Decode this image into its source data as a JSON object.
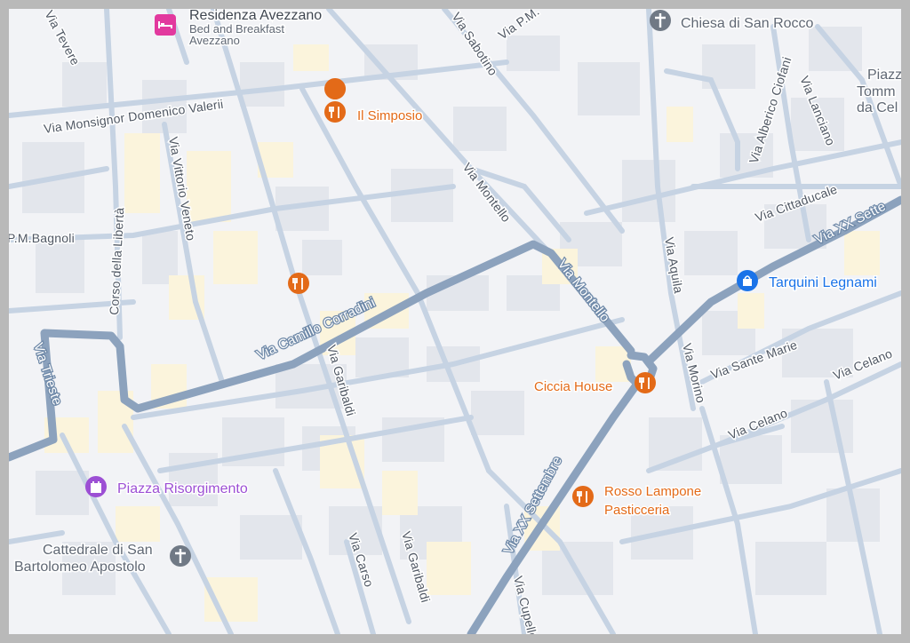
{
  "map": {
    "streets": [
      {
        "id": "via-monsignor-domenico-valerii",
        "label": "Via Monsignor Domenico Valerii"
      },
      {
        "id": "via-tevere",
        "label": "Via Tevere"
      },
      {
        "id": "via-sabotino",
        "label": "Via Sabotino"
      },
      {
        "id": "via-p-m",
        "label": "Via P.M."
      },
      {
        "id": "via-p-m-bagnoli",
        "label": "P.M.Bagnoli"
      },
      {
        "id": "corso-della-liberta",
        "label": "Corso della Libertà"
      },
      {
        "id": "via-vittorio-veneto",
        "label": "Via Vittorio Veneto"
      },
      {
        "id": "via-montello-upper",
        "label": "Via Montello"
      },
      {
        "id": "via-montello-lower",
        "label": "Via Montello"
      },
      {
        "id": "via-camillo-corradini",
        "label": "Via Camillo Corradini"
      },
      {
        "id": "via-trieste",
        "label": "Via Trieste"
      },
      {
        "id": "via-garibaldi-upper",
        "label": "Via Garibaldi"
      },
      {
        "id": "via-garibaldi-lower",
        "label": "Via Garibaldi"
      },
      {
        "id": "via-carso",
        "label": "Via Carso"
      },
      {
        "id": "via-xx-settembre-lower",
        "label": "Via XX Settembre"
      },
      {
        "id": "via-xx-settembre-upper",
        "label": "Via XX Sette"
      },
      {
        "id": "via-aquila",
        "label": "Via Aquila"
      },
      {
        "id": "via-morino",
        "label": "Via Morino"
      },
      {
        "id": "via-sante-marie",
        "label": "Via Sante Marie"
      },
      {
        "id": "via-celano",
        "label": "Via Celano"
      },
      {
        "id": "via-celano-2",
        "label": "Via Celano"
      },
      {
        "id": "via-cittaducale",
        "label": "Via Cittaducale"
      },
      {
        "id": "via-alberico-ciofani",
        "label": "Via Alberico Ciofani"
      },
      {
        "id": "via-lanciano",
        "label": "Via Lanciano"
      },
      {
        "id": "via-cupello",
        "label": "Via Cupello"
      }
    ],
    "pois": [
      {
        "id": "residenza-avezzano",
        "type": "hotel",
        "icon": "bed-icon",
        "label": "Residenza Avezzano",
        "sublabel_1": "Bed and Breakfast",
        "sublabel_2": "Avezzano"
      },
      {
        "id": "chiesa-di-san-rocco",
        "type": "worship",
        "icon": "cross-icon",
        "label": "Chiesa di San Rocco"
      },
      {
        "id": "il-simposio",
        "type": "food",
        "icon": "fork-knife-icon",
        "label": "Il Simposio"
      },
      {
        "id": "restaurant-unlabeled",
        "type": "food",
        "icon": "fork-knife-icon",
        "label": ""
      },
      {
        "id": "ciccia-house",
        "type": "food",
        "icon": "fork-knife-icon",
        "label": "Ciccia House"
      },
      {
        "id": "rosso-lampone",
        "type": "food",
        "icon": "fork-knife-icon",
        "label": "Rosso Lampone",
        "sublabel_1": "Pasticceria"
      },
      {
        "id": "tarquini-legnami",
        "type": "shop",
        "icon": "shopping-bag-icon",
        "label": "Tarquini Legnami"
      },
      {
        "id": "piazza-risorgimento",
        "type": "square",
        "icon": "castle-icon",
        "label": "Piazza Risorgimento"
      },
      {
        "id": "cattedrale",
        "type": "worship",
        "icon": "cross-icon",
        "label": "Cattedrale di San",
        "sublabel_1": "Bartolomeo Apostolo"
      },
      {
        "id": "piazza-tommaso",
        "type": "square",
        "icon": "",
        "label": "Piazz",
        "sublabel_1": "Tomm",
        "sublabel_2": "da Cel"
      }
    ],
    "colors": {
      "background": "#f2f3f6",
      "building": "#e3e6ec",
      "building_yellow": "#fbf4dc",
      "street": "#c6d3e3",
      "major_road": "#8ca2bd",
      "food": "#e36a18",
      "worship": "#707985",
      "shop": "#1a73e8",
      "square": "#9c4fd4",
      "hotel": "#e2399e"
    }
  }
}
